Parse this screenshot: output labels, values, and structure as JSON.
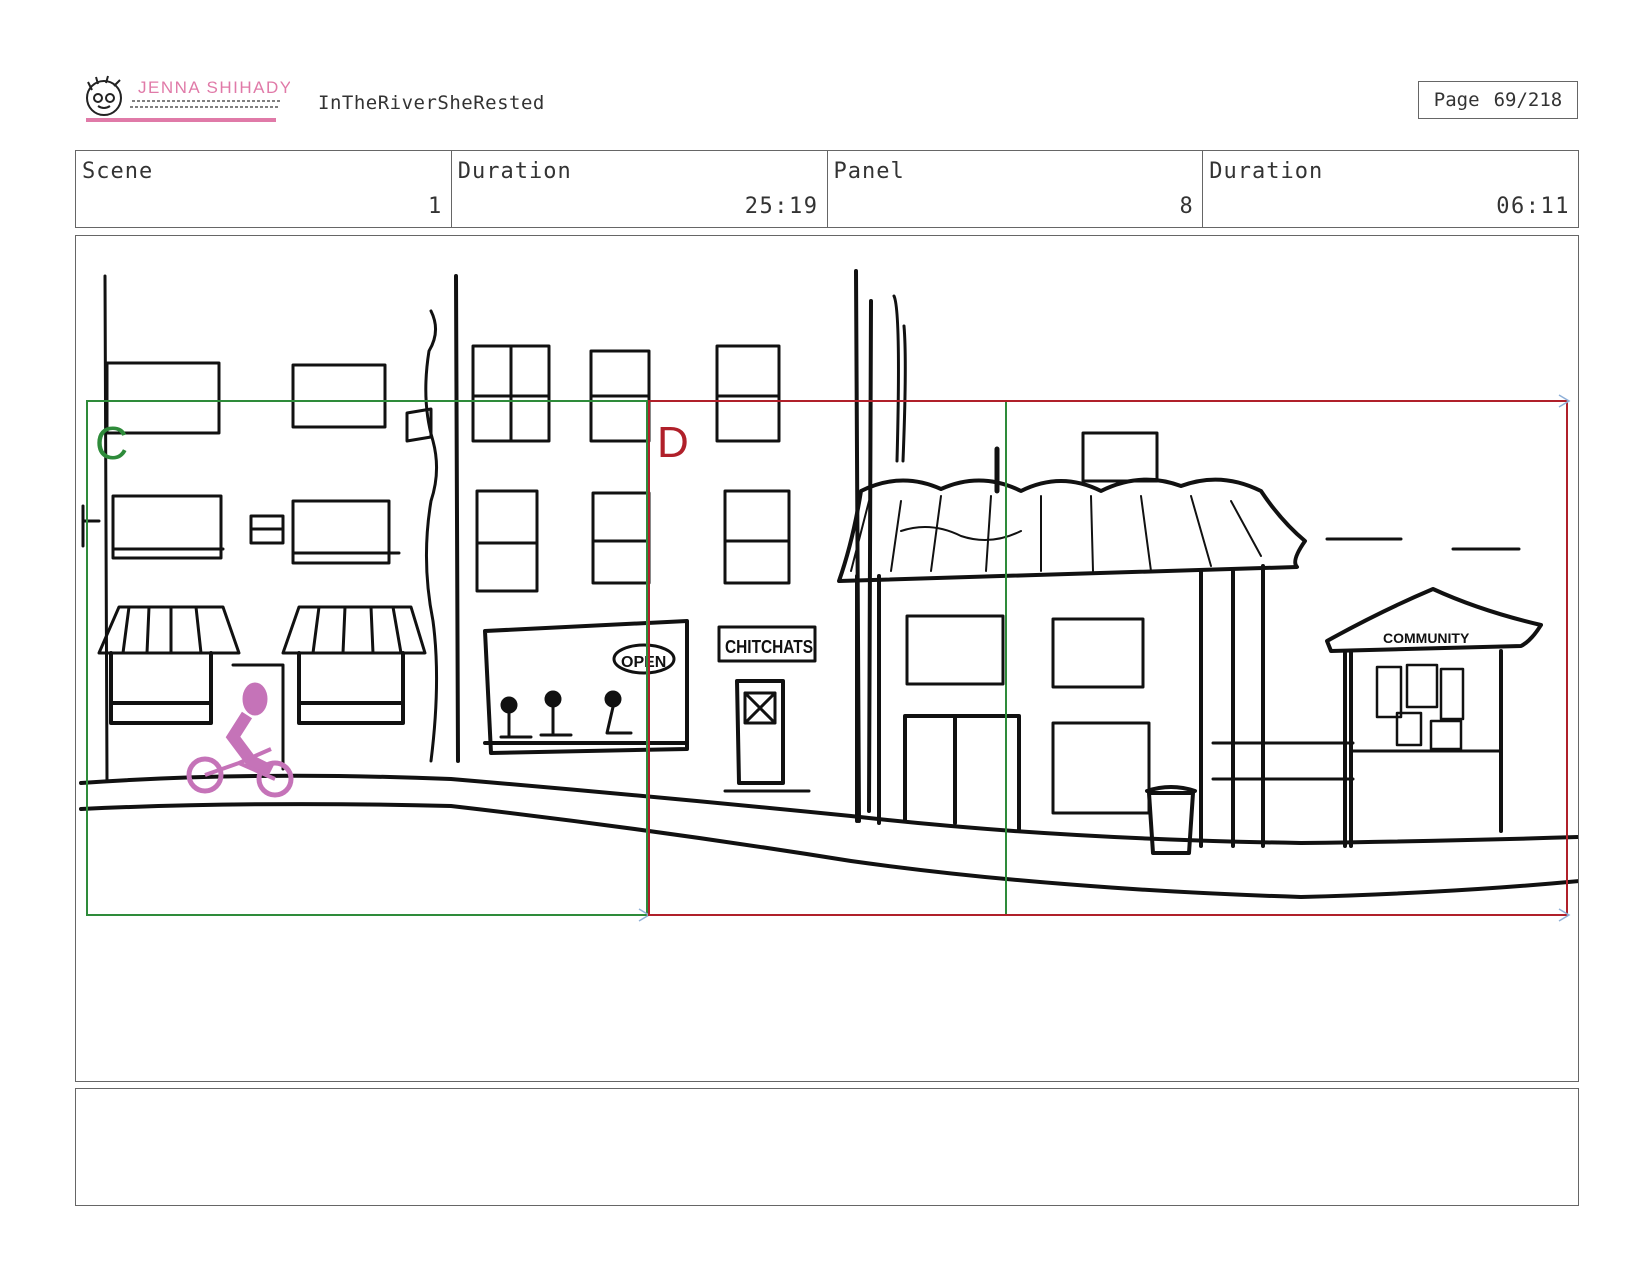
{
  "header": {
    "logo_name": "JENNA SHIHADY",
    "project_title": "InTheRiverSheRested",
    "page_label": "Page",
    "page_value": "69/218"
  },
  "info": {
    "scene_label": "Scene",
    "scene_value": "1",
    "scene_duration_label": "Duration",
    "scene_duration_value": "25:19",
    "panel_label": "Panel",
    "panel_value": "8",
    "panel_duration_label": "Duration",
    "panel_duration_value": "06:11"
  },
  "sketch": {
    "camera_c_label": "C",
    "camera_d_label": "D",
    "sign_open": "OPEN",
    "sign_chitchats": "CHITCHATS",
    "sign_community": "COMMUNITY",
    "colors": {
      "camera_c": "#2e8b3a",
      "camera_d": "#b0202a",
      "bike_rider": "#c573b8",
      "ink": "#111111",
      "logo_pink": "#e07aa8"
    }
  },
  "notes": {}
}
